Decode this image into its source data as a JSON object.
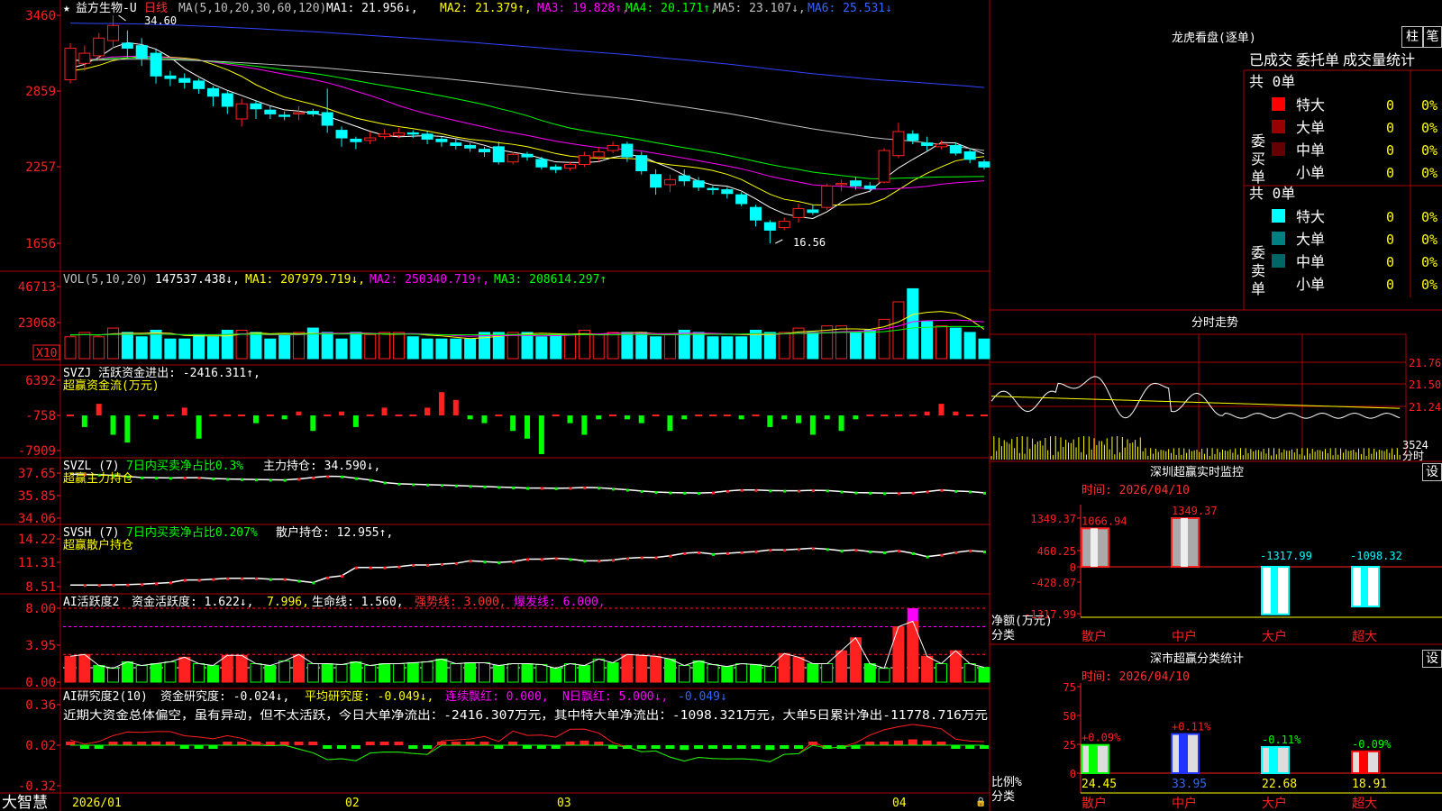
{
  "header": {
    "star": "★",
    "stock_name": "益方生物-U",
    "period": "日线",
    "ma_label": "MA(5,10,20,30,60,120)",
    "ma_values": [
      {
        "text": "MA1: 21.956↓,",
        "color": "#ffffff"
      },
      {
        "text": "MA2: 21.379↑,",
        "color": "#ffff00"
      },
      {
        "text": "MA3: 19.828↑,",
        "color": "#ff00ff"
      },
      {
        "text": "MA4: 20.171↑,",
        "color": "#00ff00"
      },
      {
        "text": "MA5: 23.107↓,",
        "color": "#c0c0c0"
      },
      {
        "text": "MA6: 25.531↓",
        "color": "#3366ff"
      }
    ]
  },
  "price_axis": [
    "3460",
    "2859",
    "2257",
    "1656"
  ],
  "price_annotations": {
    "high": "34.60",
    "low": "16.56"
  },
  "vol_panel": {
    "label": "VOL(5,10,20)",
    "value": "147537.438↓,",
    "ma": [
      {
        "text": "MA1: 207979.719↓,",
        "color": "#ffff00"
      },
      {
        "text": "MA2: 250340.719↑,",
        "color": "#ff00ff"
      },
      {
        "text": "MA3: 208614.297↑",
        "color": "#00ff00"
      }
    ],
    "axis": [
      "46713",
      "23068"
    ],
    "unit": "X10"
  },
  "svzj_panel": {
    "label": "SVZJ  活跃资金进出: -2416.311↑,",
    "sub": "超赢资金流(万元)",
    "axis": [
      "6392",
      "-758",
      "-7909"
    ]
  },
  "svzl_panel": {
    "label": "SVZL (7)",
    "info": "7日内买卖净占比0.3%",
    "extra": "主力持仓: 34.590↓,",
    "sub": "超赢主力持仓",
    "axis": [
      "37.65",
      "35.85",
      "34.06"
    ]
  },
  "svsh_panel": {
    "label": "SVSH (7)",
    "info": "7日内买卖净占比0.207%",
    "extra": "散户持仓: 12.955↑,",
    "sub": "超赢散户持仓",
    "axis": [
      "14.22",
      "11.31",
      "8.51"
    ]
  },
  "ai_active_panel": {
    "label": "AI活跃度2",
    "p1": "资金活跃度: 1.622↓,",
    "p2": "7.996,",
    "p3": "生命线: 1.560,",
    "p4": "强势线: 3.000,",
    "p5": "爆发线: 6.000,",
    "axis": [
      "8.00",
      "3.95",
      "0.00"
    ]
  },
  "ai_research_panel": {
    "label": "AI研究度2(10)",
    "p1": "资金研究度: -0.024↓,",
    "p2": "平均研究度: -0.049↓,",
    "p3": "连续飘红: 0.000,",
    "p4": "N日飘红: 5.000↓,",
    "p5": "-0.049↓",
    "comment": "近期大资金总体偏空，虽有异动，但不太活跃，今日大单净流出：-2416.307万元，其中特大单净流出：-1098.321万元，大单5日累计净出-11778.716万元",
    "axis": [
      "0.36",
      "0.02",
      "-0.32"
    ]
  },
  "date_axis": [
    "2026/01",
    "02",
    "03",
    "04"
  ],
  "logo": "大智慧",
  "longhu": {
    "title": "龙虎看盘(逐单)",
    "btn_pillar": "柱",
    "btn_pen": "笔",
    "tabs": [
      "已成交",
      "委托单",
      "成交量统计"
    ],
    "buy": {
      "label": "委买单",
      "total": "共 0单",
      "rows": [
        {
          "name": "特大",
          "count": "0",
          "pct": "0%",
          "color": "#ff0000"
        },
        {
          "name": "大单",
          "count": "0",
          "pct": "0%",
          "color": "#990000"
        },
        {
          "name": "中单",
          "count": "0",
          "pct": "0%",
          "color": "#660000"
        },
        {
          "name": "小单",
          "count": "0",
          "pct": "0%",
          "color": "#000000"
        }
      ]
    },
    "sell": {
      "label": "委卖单",
      "total": "共 0单",
      "rows": [
        {
          "name": "特大",
          "count": "0",
          "pct": "0%",
          "color": "#00ffff"
        },
        {
          "name": "大单",
          "count": "0",
          "pct": "0%",
          "color": "#008080"
        },
        {
          "name": "中单",
          "count": "0",
          "pct": "0%",
          "color": "#006666"
        },
        {
          "name": "小单",
          "count": "0",
          "pct": "0%",
          "color": "#000000"
        }
      ]
    }
  },
  "intraday": {
    "title": "分时走势",
    "axis": [
      "21.76",
      "21.50",
      "21.24"
    ],
    "vol_label": "3524",
    "sub": "分时"
  },
  "sz_monitor": {
    "title": "深圳超赢实时监控",
    "setting": "设",
    "time": "时间: 2026/04/10",
    "axis": [
      "1349.37",
      "460.25",
      "0",
      "-428.87",
      "-1317.99"
    ],
    "y_label": "净额(万元)",
    "x_label": "分类",
    "bars": [
      {
        "cat": "散户",
        "value": 1066.94,
        "label": "1066.94"
      },
      {
        "cat": "中户",
        "value": 1349.37,
        "label": "1349.37"
      },
      {
        "cat": "大户",
        "value": -1317.99,
        "label": "-1317.99"
      },
      {
        "cat": "超大",
        "value": -1098.32,
        "label": "-1098.32"
      }
    ]
  },
  "sz_class": {
    "title": "深市超赢分类统计",
    "setting": "设",
    "time": "时间: 2026/04/10",
    "axis": [
      "75",
      "50",
      "25",
      "0"
    ],
    "y_label": "比例%",
    "x_label": "分类",
    "bars": [
      {
        "cat": "散户",
        "value": 24.45,
        "change": "+0.09%",
        "color": "#00ff00"
      },
      {
        "cat": "中户",
        "value": 33.95,
        "change": "+0.11%",
        "color": "#2233ff"
      },
      {
        "cat": "大户",
        "value": 22.68,
        "change": "-0.11%",
        "color": "#00ffff"
      },
      {
        "cat": "超大",
        "value": 18.91,
        "change": "-0.09%",
        "color": "#ff0000"
      }
    ]
  },
  "series": {
    "candles": [
      [
        29.5,
        32.0,
        29.2,
        32.4
      ],
      [
        30.8,
        31.6,
        30.2,
        32.2
      ],
      [
        31.4,
        32.8,
        31.0,
        33.2
      ],
      [
        32.6,
        33.8,
        32.0,
        34.6
      ],
      [
        32.4,
        32.0,
        31.2,
        33.4
      ],
      [
        32.2,
        31.2,
        30.6,
        32.8
      ],
      [
        31.6,
        29.8,
        29.2,
        31.9
      ],
      [
        29.8,
        29.6,
        29.0,
        30.2
      ],
      [
        29.6,
        29.3,
        28.8,
        30.0
      ],
      [
        29.4,
        28.8,
        28.4,
        29.6
      ],
      [
        28.8,
        28.2,
        27.4,
        29.0
      ],
      [
        28.4,
        27.4,
        26.8,
        28.6
      ],
      [
        26.4,
        27.6,
        25.8,
        28.0
      ],
      [
        27.6,
        27.2,
        26.4,
        27.9
      ],
      [
        27.1,
        26.8,
        26.4,
        27.4
      ],
      [
        26.7,
        26.6,
        26.3,
        27.0
      ],
      [
        26.8,
        26.9,
        26.3,
        27.4
      ],
      [
        27.0,
        26.8,
        26.6,
        27.2
      ],
      [
        26.9,
        25.9,
        25.3,
        28.8
      ],
      [
        25.5,
        24.9,
        24.2,
        25.8
      ],
      [
        24.8,
        24.6,
        24.0,
        25.0
      ],
      [
        24.7,
        24.9,
        24.4,
        25.4
      ],
      [
        25.0,
        25.2,
        24.8,
        25.6
      ],
      [
        25.1,
        25.3,
        24.9,
        25.7
      ],
      [
        25.3,
        25.2,
        24.9,
        25.5
      ],
      [
        25.2,
        24.8,
        24.4,
        25.4
      ],
      [
        24.8,
        24.6,
        24.2,
        25.0
      ],
      [
        24.5,
        24.3,
        24.0,
        24.8
      ],
      [
        24.3,
        24.1,
        23.8,
        24.5
      ],
      [
        24.0,
        23.8,
        23.4,
        24.2
      ],
      [
        24.2,
        23.0,
        22.8,
        24.6
      ],
      [
        23.0,
        23.6,
        22.8,
        23.8
      ],
      [
        23.6,
        23.4,
        23.1,
        23.8
      ],
      [
        23.2,
        22.6,
        22.4,
        23.4
      ],
      [
        22.6,
        22.4,
        22.1,
        22.8
      ],
      [
        22.5,
        22.8,
        22.3,
        23.0
      ],
      [
        22.8,
        23.5,
        22.6,
        23.8
      ],
      [
        23.4,
        23.8,
        23.0,
        24.2
      ],
      [
        23.9,
        24.3,
        23.7,
        24.6
      ],
      [
        24.4,
        23.4,
        23.0,
        24.6
      ],
      [
        23.5,
        22.3,
        22.0,
        23.8
      ],
      [
        22.0,
        21.0,
        20.4,
        22.4
      ],
      [
        21.2,
        21.6,
        20.6,
        22.0
      ],
      [
        21.9,
        21.5,
        21.1,
        22.4
      ],
      [
        21.5,
        21.0,
        20.7,
        21.8
      ],
      [
        20.9,
        20.8,
        20.4,
        21.1
      ],
      [
        20.8,
        20.5,
        20.1,
        21.0
      ],
      [
        20.4,
        19.7,
        19.5,
        20.6
      ],
      [
        19.4,
        18.4,
        17.9,
        19.6
      ],
      [
        18.2,
        17.6,
        16.56,
        18.4
      ],
      [
        17.8,
        18.3,
        17.6,
        18.6
      ],
      [
        18.6,
        19.3,
        18.2,
        19.7
      ],
      [
        19.2,
        19.0,
        18.8,
        19.6
      ],
      [
        19.4,
        21.1,
        19.2,
        21.3
      ],
      [
        21.2,
        21.3,
        20.7,
        21.6
      ],
      [
        21.5,
        21.1,
        20.8,
        21.8
      ],
      [
        21.1,
        20.9,
        20.6,
        21.4
      ],
      [
        21.4,
        23.9,
        21.3,
        24.1
      ],
      [
        23.5,
        25.4,
        23.3,
        26.1
      ],
      [
        25.2,
        24.7,
        24.4,
        25.5
      ],
      [
        24.5,
        24.3,
        23.9,
        25.0
      ],
      [
        24.2,
        24.4,
        24.0,
        24.7
      ],
      [
        24.3,
        23.7,
        23.5,
        24.5
      ],
      [
        23.8,
        23.2,
        22.9,
        24.0
      ],
      [
        23.0,
        22.6,
        22.4,
        23.2
      ]
    ],
    "vol": [
      10,
      12,
      10,
      14,
      12,
      10,
      13,
      9,
      9,
      11,
      10,
      13,
      13,
      12,
      9,
      11,
      12,
      14,
      12,
      9,
      12,
      11,
      12,
      12,
      10,
      9,
      9,
      9,
      9,
      12,
      12,
      12,
      12,
      10,
      11,
      11,
      13,
      11,
      12,
      12,
      12,
      10,
      11,
      13,
      12,
      10,
      10,
      10,
      13,
      12,
      12,
      14,
      12,
      15,
      15,
      12,
      13,
      18,
      26,
      32,
      17,
      15,
      14,
      12,
      9
    ],
    "svzj": [
      0,
      -3,
      3,
      -5,
      -7,
      0,
      -1,
      0,
      2,
      -6,
      0,
      0,
      0,
      -2,
      0,
      -1,
      1,
      -4,
      0,
      1,
      -3,
      0,
      2,
      0,
      0,
      2,
      6,
      4,
      -1,
      -2,
      0,
      -4,
      -6,
      -10,
      0,
      -2,
      -5,
      -1,
      0,
      -1,
      -2,
      0,
      -4,
      -1,
      0,
      0,
      0,
      -1,
      0,
      -3,
      -1,
      -2,
      -5,
      -1,
      -4,
      -1,
      0,
      0,
      0,
      0,
      1,
      3,
      1,
      0,
      0
    ],
    "svzl": [
      37.55,
      37.55,
      37.52,
      37.46,
      37.38,
      37.3,
      37.28,
      37.26,
      37.28,
      37.28,
      37.22,
      37.18,
      37.16,
      37.14,
      37.12,
      37.1,
      37.18,
      37.3,
      37.4,
      37.38,
      37.24,
      37.1,
      36.9,
      36.8,
      36.76,
      36.73,
      36.7,
      36.66,
      36.62,
      36.58,
      36.54,
      36.5,
      36.46,
      36.46,
      36.44,
      36.46,
      36.5,
      36.48,
      36.4,
      36.32,
      36.22,
      36.14,
      36.1,
      36.08,
      36.06,
      36.1,
      36.22,
      36.3,
      36.3,
      36.26,
      36.24,
      36.24,
      36.28,
      36.26,
      36.18,
      36.1,
      36.08,
      36.05,
      36.05,
      36.08,
      36.18,
      36.3,
      36.22,
      36.18,
      36.08
    ],
    "svsh": [
      8.7,
      8.7,
      8.7,
      8.72,
      8.75,
      8.8,
      8.9,
      9.0,
      9.3,
      9.3,
      9.4,
      9.5,
      9.5,
      9.5,
      9.4,
      9.4,
      9.2,
      9.0,
      9.6,
      9.8,
      10.8,
      10.8,
      10.8,
      10.9,
      11.1,
      11.1,
      11.2,
      11.3,
      11.6,
      11.5,
      11.4,
      11.5,
      11.8,
      11.8,
      11.9,
      11.8,
      11.6,
      11.6,
      11.7,
      11.9,
      12.0,
      12.0,
      12.2,
      12.5,
      12.6,
      12.4,
      12.5,
      12.6,
      12.7,
      12.9,
      12.9,
      13.0,
      13.1,
      13.0,
      12.8,
      12.9,
      12.7,
      12.6,
      12.8,
      12.5,
      12.1,
      12.3,
      12.6,
      12.8,
      12.7
    ],
    "act": [
      2.8,
      3.0,
      1.8,
      1.5,
      2.2,
      1.8,
      2.0,
      2.2,
      2.7,
      2.0,
      1.8,
      2.9,
      2.9,
      2.0,
      1.8,
      2.3,
      3.0,
      2.0,
      2.0,
      1.9,
      2.2,
      1.8,
      2.0,
      2.0,
      2.1,
      2.2,
      2.5,
      2.0,
      2.1,
      2.1,
      1.8,
      2.0,
      2.0,
      1.9,
      1.5,
      2.0,
      1.8,
      2.5,
      2.1,
      3.0,
      2.9,
      2.8,
      2.5,
      1.8,
      2.3,
      1.9,
      1.7,
      2.0,
      1.9,
      1.7,
      3.1,
      2.7,
      2.0,
      2.0,
      3.4,
      4.8,
      2.0,
      1.5,
      6.0,
      6.6,
      2.8,
      2.0,
      3.4,
      2.0,
      1.6
    ],
    "res": [
      0.03,
      -0.01,
      -0.01,
      0.01,
      0.02,
      0.01,
      0.01,
      0.01,
      -0.01,
      -0.01,
      -0.01,
      0.02,
      0.02,
      0.01,
      0.01,
      0.03,
      0.02,
      0.01,
      -0.02,
      -0.01,
      -0.02,
      0.02,
      0.02,
      0.01,
      -0.01,
      -0.03,
      0.03,
      0.02,
      0.01,
      0.01,
      -0.03,
      0.02,
      -0.01,
      -0.01,
      -0.02,
      0.03,
      0.04,
      0.03,
      -0.01,
      -0.02,
      -0.03,
      -0.01,
      -0.03,
      -0.04,
      -0.01,
      -0.01,
      -0.01,
      -0.01,
      -0.02,
      -0.04,
      -0.01,
      -0.02,
      0.03,
      -0.02,
      -0.03,
      -0.02,
      0.01,
      0.03,
      0.04,
      0.05,
      0.04,
      0.03,
      -0.02,
      -0.02,
      -0.01
    ]
  }
}
